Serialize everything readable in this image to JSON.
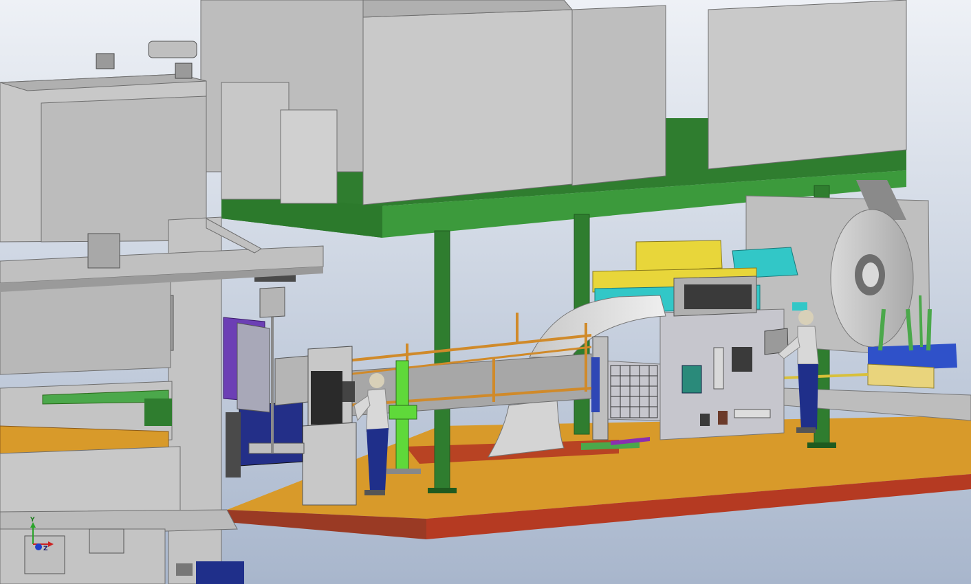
{
  "viewport": {
    "background_top": "#eef1f6",
    "background_bottom": "#a8b6cc"
  },
  "colors": {
    "press_gray": "#c4c4c4",
    "press_dark": "#8e8e8e",
    "platform_green": "#2f7d2f",
    "platform_green_dark": "#1f5a1f",
    "floor_orange": "#d89a2a",
    "floor_red": "#b53a22",
    "feeder_yellow": "#e8d63a",
    "leveler_cyan": "#32c7c7",
    "operator_shirt": "#d8d8d8",
    "operator_pants": "#1f2f8a",
    "cabinet_purple": "#6c3fb5",
    "cabinet_navy": "#232f88",
    "guide_green": "#5fd93a"
  },
  "triad": {
    "x_label": "",
    "y_label": "Y",
    "z_label": "Z"
  }
}
